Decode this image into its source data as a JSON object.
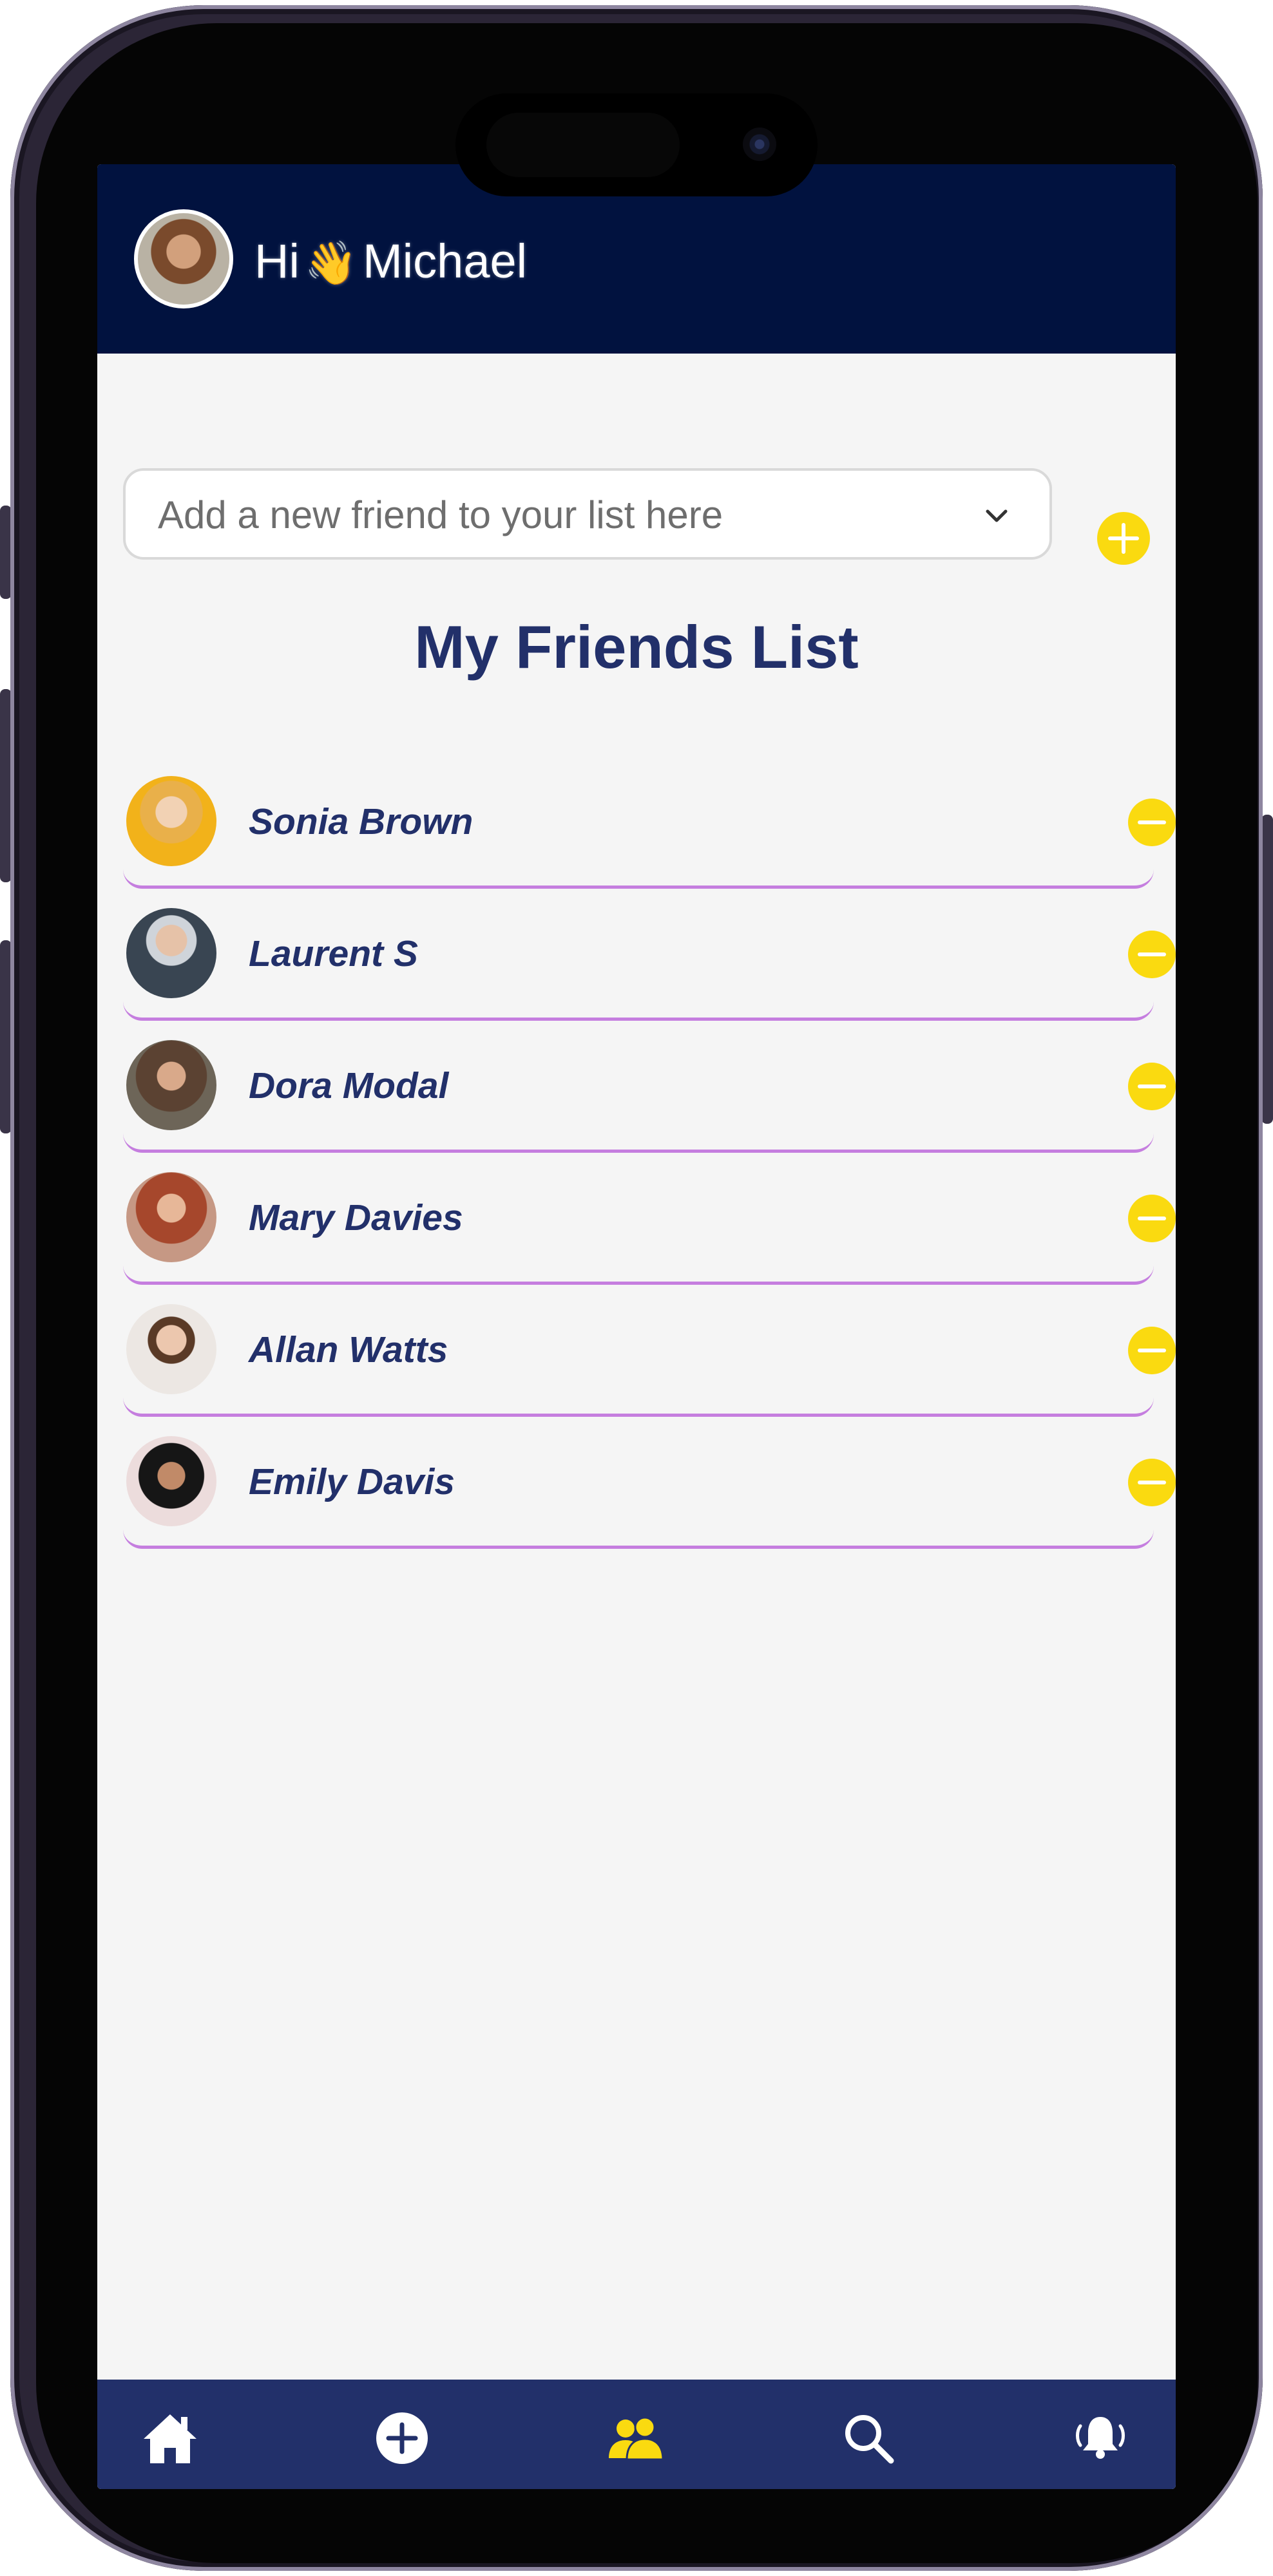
{
  "header": {
    "greeting_prefix": "Hi",
    "wave_emoji": "👋",
    "user_name": "Michael"
  },
  "search": {
    "placeholder": "Add a new friend to your list here"
  },
  "page_title": "My Friends List",
  "friends": [
    {
      "name": "Sonia Brown"
    },
    {
      "name": "Laurent S"
    },
    {
      "name": "Dora Modal"
    },
    {
      "name": "Mary Davies"
    },
    {
      "name": "Allan Watts"
    },
    {
      "name": "Emily Davis"
    }
  ],
  "nav": {
    "items": [
      {
        "icon": "home-icon",
        "active": false
      },
      {
        "icon": "plus-circle-icon",
        "active": false
      },
      {
        "icon": "friends-icon",
        "active": true
      },
      {
        "icon": "search-icon",
        "active": false
      },
      {
        "icon": "bell-ringing-icon",
        "active": false
      }
    ]
  },
  "colors": {
    "header_bg": "#01123f",
    "accent_yellow": "#fada10",
    "text_navy": "#22306a",
    "divider_purple": "#c57edf",
    "nav_bg": "#22306a"
  }
}
